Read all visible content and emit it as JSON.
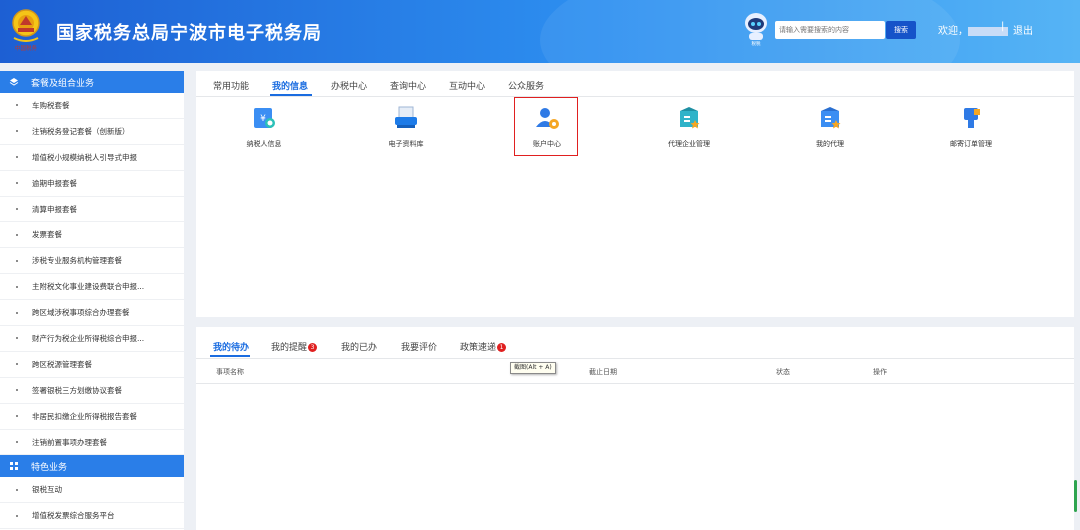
{
  "header": {
    "title": "国家税务总局宁波市电子税务局",
    "search_placeholder": "请输入需要搜索的内容",
    "search_button": "搜索",
    "welcome": "欢迎，",
    "separator": "|",
    "logout": "退出",
    "emblem_caption": "中国税务",
    "robot_caption": "税税"
  },
  "sidebar": {
    "group1": "套餐及组合业务",
    "items1": [
      "车购税套餐",
      "注销税务登记套餐（创新版）",
      "增值税小规模纳税人引导式申报",
      "逾期申报套餐",
      "清算申报套餐",
      "发票套餐",
      "涉税专业服务机构管理套餐",
      "主附税文化事业建设费联合申报...",
      "跨区域涉税事项综合办理套餐",
      "财产行为税企业所得税综合申报...",
      "跨区税源管理套餐",
      "签署银税三方划缴协议套餐",
      "非居民扣缴企业所得税报告套餐",
      "注销前置事项办理套餐"
    ],
    "group2": "特色业务",
    "items2": [
      "银税互动",
      "增值税发票综合服务平台"
    ]
  },
  "top_tabs": [
    "常用功能",
    "我的信息",
    "办税中心",
    "查询中心",
    "互动中心",
    "公众服务"
  ],
  "tiles": [
    {
      "label": "纳税人信息",
      "icon": "taxpayer-info-icon"
    },
    {
      "label": "电子资料库",
      "icon": "e-archive-icon"
    },
    {
      "label": "账户中心",
      "icon": "account-center-icon"
    },
    {
      "label": "代理企业管理",
      "icon": "agent-enterprise-icon"
    },
    {
      "label": "我的代理",
      "icon": "my-agent-icon"
    },
    {
      "label": "邮寄订单管理",
      "icon": "mail-order-icon"
    }
  ],
  "bottom_tabs": {
    "todo": "我的待办",
    "reminders": "我的提醒",
    "reminders_count": "3",
    "done": "我的已办",
    "evaluate": "我要评价",
    "policy": "政策速递",
    "policy_count": "1"
  },
  "columns": [
    "事项名称",
    "截止日期",
    "状态",
    "操作"
  ],
  "tooltip": "截图(Alt + A)",
  "colors": {
    "accent": "#1a6ce0",
    "header_start": "#1d5fd3",
    "header_end": "#56b4f5",
    "badge": "#e02020",
    "highlight": "#e02020"
  }
}
